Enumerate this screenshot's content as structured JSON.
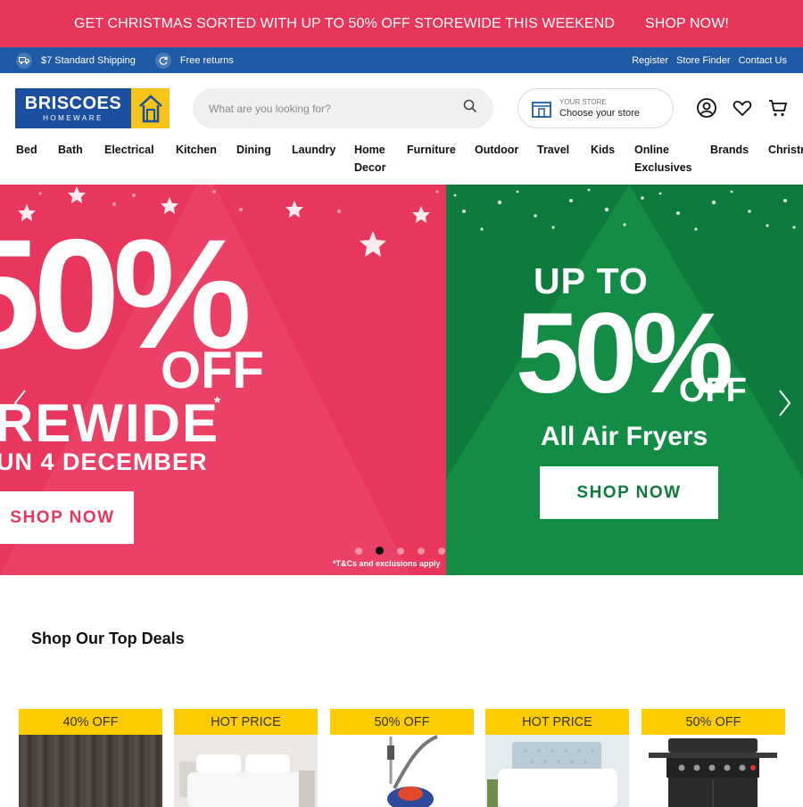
{
  "promo": {
    "text": "GET CHRISTMAS SORTED WITH UP TO 50% OFF STOREWIDE THIS WEEKEND",
    "link": "SHOP NOW!"
  },
  "info_bar": {
    "shipping": "$7 Standard Shipping",
    "returns": "Free returns",
    "links": [
      "Register",
      "Store Finder",
      "Contact Us"
    ]
  },
  "logo": {
    "word": "BRISCOES",
    "sub": "HOMEWARE"
  },
  "search": {
    "placeholder": "What are you looking for?"
  },
  "store": {
    "label_small": "YOUR STORE",
    "label_main": "Choose your store"
  },
  "nav": [
    {
      "label": "Bed"
    },
    {
      "label": "Bath"
    },
    {
      "label": "Electrical"
    },
    {
      "label": "Kitchen"
    },
    {
      "label": "Dining"
    },
    {
      "label": "Laundry"
    },
    {
      "label": "Home Decor"
    },
    {
      "label": "Furniture"
    },
    {
      "label": "Outdoor"
    },
    {
      "label": "Travel"
    },
    {
      "label": "Kids"
    },
    {
      "label": "Online Exclusives"
    },
    {
      "label": "Brands"
    },
    {
      "label": "Christmas"
    }
  ],
  "hero_left": {
    "percent": "50%",
    "off": "OFF",
    "line1": "REWIDE",
    "star": "*",
    "line2": "UN 4 DECEMBER",
    "button": "SHOP NOW",
    "disclaimer": "*T&Cs and exclusions apply"
  },
  "hero_right": {
    "up_to": "UP TO",
    "percent": "50%",
    "off": "OFF",
    "subtitle": "All Air Fryers",
    "button": "SHOP NOW"
  },
  "carousel": {
    "active_index": 1,
    "count": 5
  },
  "top_deals": {
    "title": "Shop Our Top Deals",
    "items": [
      {
        "badge": "40% OFF",
        "image": "curtain"
      },
      {
        "badge": "HOT PRICE",
        "image": "bed-linen"
      },
      {
        "badge": "50% OFF",
        "image": "vacuum"
      },
      {
        "badge": "HOT PRICE",
        "image": "duvet"
      },
      {
        "badge": "50% OFF",
        "image": "bbq"
      }
    ]
  },
  "colors": {
    "promo": "#e8355a",
    "info_bar": "#1f5aa6",
    "hero_left": "#e8365c",
    "hero_right": "#0f7a3d",
    "badge": "#ffcc00"
  }
}
